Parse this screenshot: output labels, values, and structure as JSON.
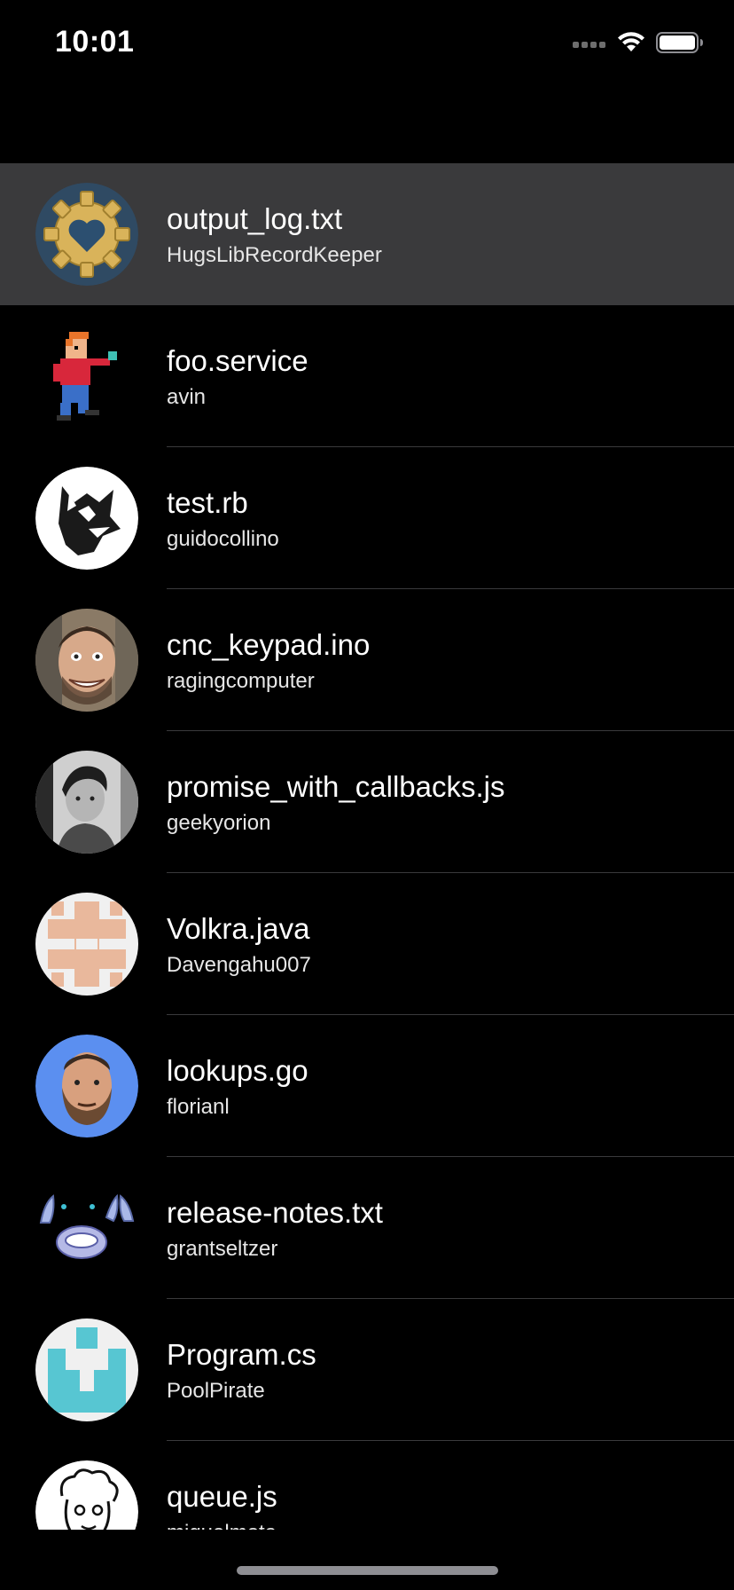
{
  "status_bar": {
    "time": "10:01",
    "icons": [
      "cellular-dots-icon",
      "wifi-icon",
      "battery-icon"
    ]
  },
  "colors": {
    "background": "#000000",
    "selected_row": "#3a3a3c",
    "separator": "#3a3a3c",
    "home_indicator": "#8e8e93"
  },
  "gists": [
    {
      "title": "output_log.txt",
      "owner": "HugsLibRecordKeeper",
      "avatar": "gear-heart-avatar",
      "selected": true
    },
    {
      "title": "foo.service",
      "owner": "avin",
      "avatar": "pixel-character-avatar"
    },
    {
      "title": "test.rb",
      "owner": "guidocollino",
      "avatar": "wolf-avatar"
    },
    {
      "title": "cnc_keypad.ino",
      "owner": "ragingcomputer",
      "avatar": "face-photo-avatar"
    },
    {
      "title": "promise_with_callbacks.js",
      "owner": "geekyorion",
      "avatar": "bw-photo-avatar"
    },
    {
      "title": "Volkra.java",
      "owner": "Davengahu007",
      "avatar": "identicon-avatar"
    },
    {
      "title": "lookups.go",
      "owner": "florianl",
      "avatar": "bearded-face-avatar"
    },
    {
      "title": "release-notes.txt",
      "owner": "grantseltzer",
      "avatar": "creature-avatar"
    },
    {
      "title": "Program.cs",
      "owner": "PoolPirate",
      "avatar": "teal-identicon-avatar"
    },
    {
      "title": "queue.js",
      "owner": "miguelmota",
      "avatar": "cartoon-sketch-avatar"
    }
  ]
}
